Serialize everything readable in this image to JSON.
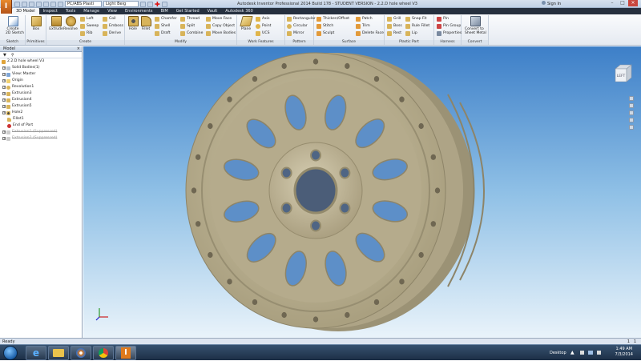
{
  "app": {
    "title": "Autodesk Inventor Professional 2014 Build 178 - STUDENT VERSION - 2.2.D hole wheel V3",
    "icon_letter": "I",
    "sign_in": "Sign In",
    "qat": {
      "material": "PC/ABS Plasti",
      "appearance": "Light Beig"
    }
  },
  "ribbon_tabs": [
    {
      "label": "3D Model",
      "active": true
    },
    {
      "label": "Inspect"
    },
    {
      "label": "Tools"
    },
    {
      "label": "Manage"
    },
    {
      "label": "View"
    },
    {
      "label": "Environments"
    },
    {
      "label": "BIM"
    },
    {
      "label": "Get Started"
    },
    {
      "label": "Vault"
    },
    {
      "label": "Autodesk 360"
    }
  ],
  "ribbon": {
    "sketch": {
      "label": "Sketch",
      "create_2d_sketch": "Create\n2D Sketch"
    },
    "primitives": {
      "label": "Primitives",
      "box": "Box"
    },
    "create": {
      "label": "Create",
      "extrude": "Extrude",
      "revolve": "Revolve",
      "loft": "Loft",
      "sweep": "Sweep",
      "rib": "Rib",
      "coil": "Coil",
      "emboss": "Emboss",
      "derive": "Derive"
    },
    "modify": {
      "label": "Modify",
      "hole": "Hole",
      "fillet": "Fillet",
      "chamfer": "Chamfer",
      "shell": "Shell",
      "draft": "Draft",
      "thread": "Thread",
      "split": "Split",
      "combine": "Combine",
      "move_face": "Move Face",
      "copy_object": "Copy Object",
      "move_bodies": "Move Bodies"
    },
    "work_features": {
      "label": "Work Features",
      "plane": "Plane",
      "axis": "Axis",
      "point": "Point",
      "ucs": "UCS"
    },
    "pattern": {
      "label": "Pattern",
      "rectangular": "Rectangular",
      "circular": "Circular",
      "mirror": "Mirror"
    },
    "surface": {
      "label": "Surface",
      "thicken_offset": "Thicken/Offset",
      "stitch": "Stitch",
      "sculpt": "Sculpt",
      "patch": "Patch",
      "trim": "Trim",
      "delete_face": "Delete Face"
    },
    "plastic_part": {
      "label": "Plastic Part",
      "grill": "Grill",
      "boss": "Boss",
      "rest": "Rest",
      "snap_fit": "Snap Fit",
      "rule_fillet": "Rule Fillet",
      "lip": "Lip"
    },
    "harness": {
      "label": "Harness",
      "pin": "Pin",
      "pin_group": "Pin Group",
      "properties": "Properties"
    },
    "convert": {
      "label": "Convert",
      "convert_to_sheet_metal": "Convert to\nSheet Metal"
    }
  },
  "browser": {
    "title": "Model",
    "tree": [
      {
        "label": "2.2.D hole wheel V3"
      },
      {
        "label": "Solid Bodies(1)"
      },
      {
        "label": "View: Master"
      },
      {
        "label": "Origin"
      },
      {
        "label": "Revolution1"
      },
      {
        "label": "Extrusion3"
      },
      {
        "label": "Extrusion4"
      },
      {
        "label": "Extrusion5"
      },
      {
        "label": "Hole2"
      },
      {
        "label": "Fillet1"
      },
      {
        "label": "End of Part"
      },
      {
        "label": "Extrusion1 (Suppressed)"
      },
      {
        "label": "Extrusion2 (Suppressed)"
      }
    ]
  },
  "viewcube": {
    "face": "LEFT"
  },
  "status": {
    "text": "Ready",
    "count_a": "1",
    "count_b": "1"
  },
  "taskbar": {
    "desktop": "Desktop",
    "time": "1:49 AM",
    "date": "7/3/2014"
  },
  "colors": {
    "wheel": "#c2b898",
    "viewport_top": "#3d7fc8",
    "viewport_bottom": "#e9f3fa"
  }
}
